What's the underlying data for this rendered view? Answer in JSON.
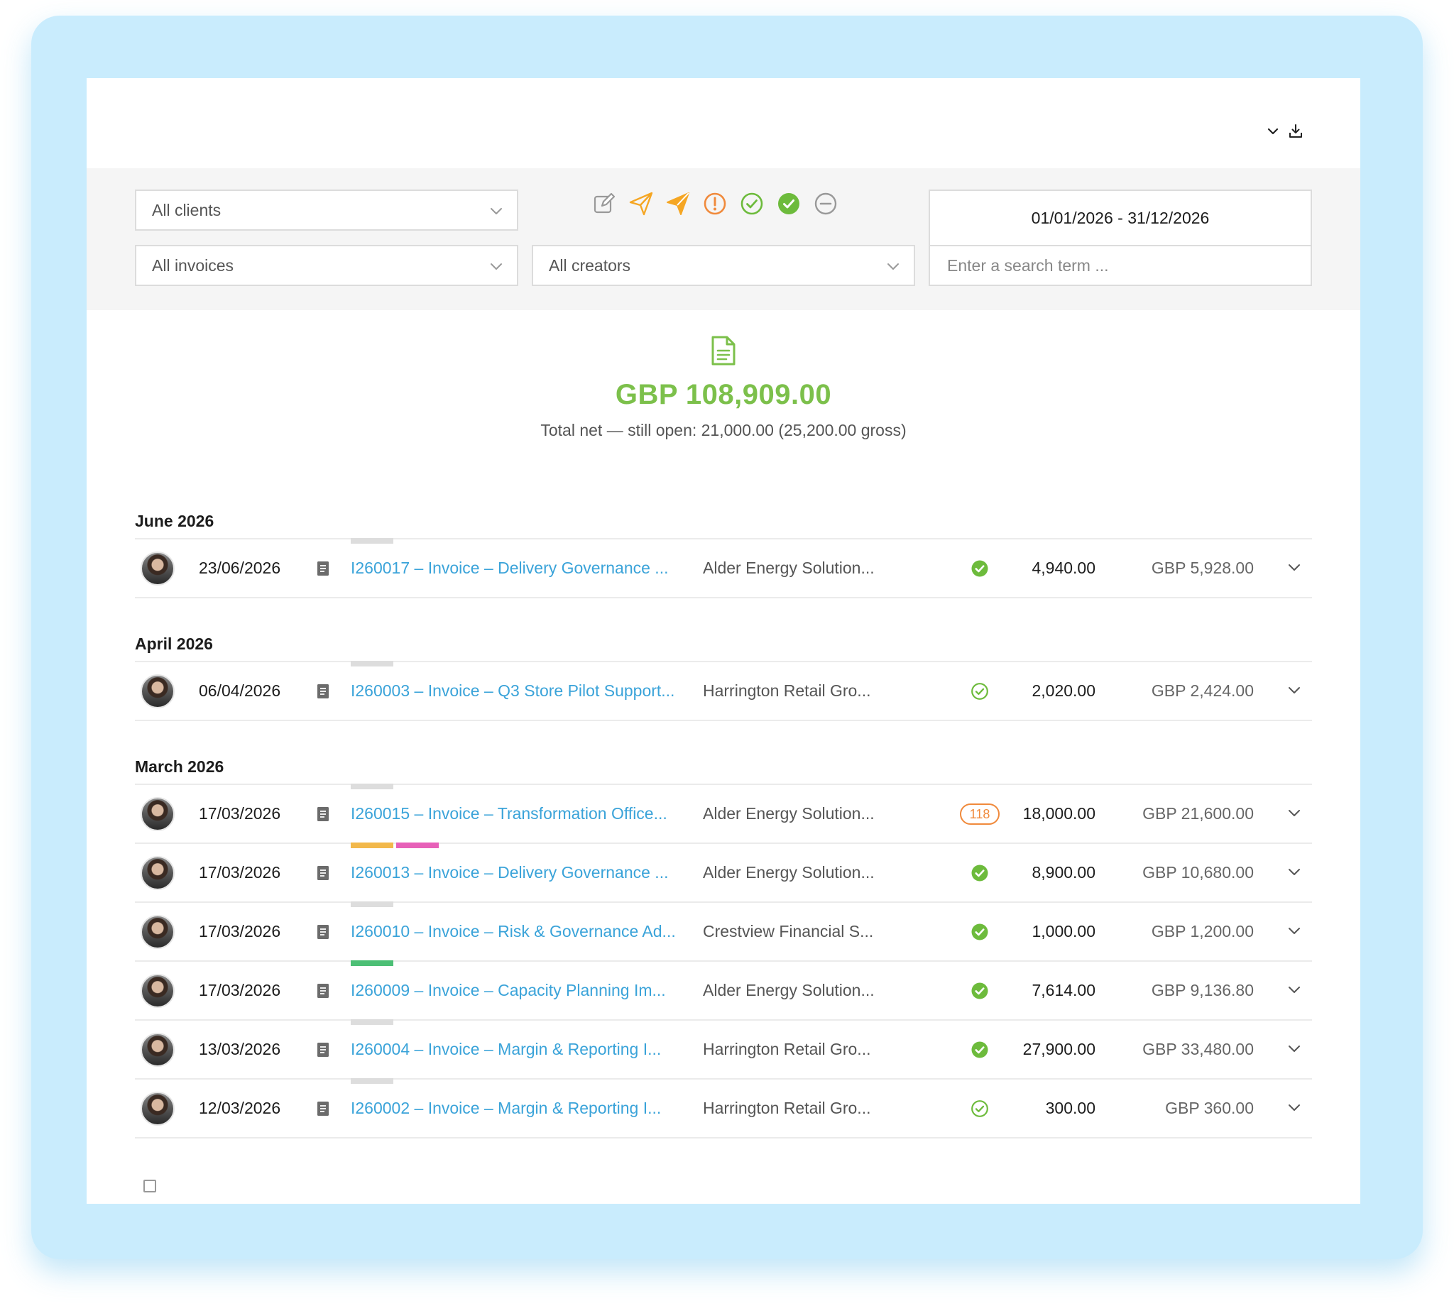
{
  "filters": {
    "clients": "All clients",
    "invoices": "All invoices",
    "creators": "All creators",
    "date_range": "01/01/2026 - 31/12/2026",
    "search_placeholder": "Enter a search term ..."
  },
  "status_filter_icons": [
    "draft-edit-icon",
    "sent-outline-icon",
    "sent-filled-icon",
    "overdue-alert-icon",
    "paid-outline-icon",
    "paid-filled-icon",
    "cancelled-icon"
  ],
  "summary": {
    "total": "GBP 108,909.00",
    "subtitle": "Total net — still open: 21,000.00 (25,200.00 gross)"
  },
  "colors": {
    "accent_green": "#7cc04b",
    "link_blue": "#3aa3d9",
    "overdue_orange": "#f08a3c",
    "frame_blue": "#c9ecfd"
  },
  "groups": [
    {
      "month": "June 2026",
      "rows": [
        {
          "date": "23/06/2026",
          "title": "I260017 – Invoice – Delivery Governance ...",
          "client": "Alder Energy Solution...",
          "status": "paid-filled",
          "net": "4,940.00",
          "gross": "GBP 5,928.00",
          "tags": [
            "#dddddd"
          ]
        }
      ]
    },
    {
      "month": "April 2026",
      "rows": [
        {
          "date": "06/04/2026",
          "title": "I260003 – Invoice – Q3 Store Pilot Support...",
          "client": "Harrington Retail Gro...",
          "status": "paid-outline",
          "net": "2,020.00",
          "gross": "GBP 2,424.00",
          "tags": [
            "#dddddd"
          ]
        }
      ]
    },
    {
      "month": "March 2026",
      "rows": [
        {
          "date": "17/03/2026",
          "title": "I260015 – Invoice – Transformation Office...",
          "client": "Alder Energy Solution...",
          "status": "overdue",
          "overdue_days": "118",
          "net": "18,000.00",
          "gross": "GBP 21,600.00",
          "tags": [
            "#dddddd"
          ]
        },
        {
          "date": "17/03/2026",
          "title": "I260013 – Invoice – Delivery Governance ...",
          "client": "Alder Energy Solution...",
          "status": "paid-filled",
          "net": "8,900.00",
          "gross": "GBP 10,680.00",
          "tags": [
            "#f2b84b",
            "#e760b8"
          ]
        },
        {
          "date": "17/03/2026",
          "title": "I260010 – Invoice – Risk & Governance Ad...",
          "client": "Crestview Financial S...",
          "status": "paid-filled",
          "net": "1,000.00",
          "gross": "GBP 1,200.00",
          "tags": [
            "#dddddd"
          ]
        },
        {
          "date": "17/03/2026",
          "title": "I260009 – Invoice – Capacity Planning Im...",
          "client": "Alder Energy Solution...",
          "status": "paid-filled",
          "net": "7,614.00",
          "gross": "GBP 9,136.80",
          "tags": [
            "#4cbf75"
          ]
        },
        {
          "date": "13/03/2026",
          "title": "I260004 – Invoice – Margin & Reporting I...",
          "client": "Harrington Retail Gro...",
          "status": "paid-filled",
          "net": "27,900.00",
          "gross": "GBP 33,480.00",
          "tags": [
            "#dddddd"
          ]
        },
        {
          "date": "12/03/2026",
          "title": "I260002 – Invoice – Margin & Reporting I...",
          "client": "Harrington Retail Gro...",
          "status": "paid-outline",
          "net": "300.00",
          "gross": "GBP 360.00",
          "tags": [
            "#dddddd"
          ]
        }
      ]
    }
  ]
}
